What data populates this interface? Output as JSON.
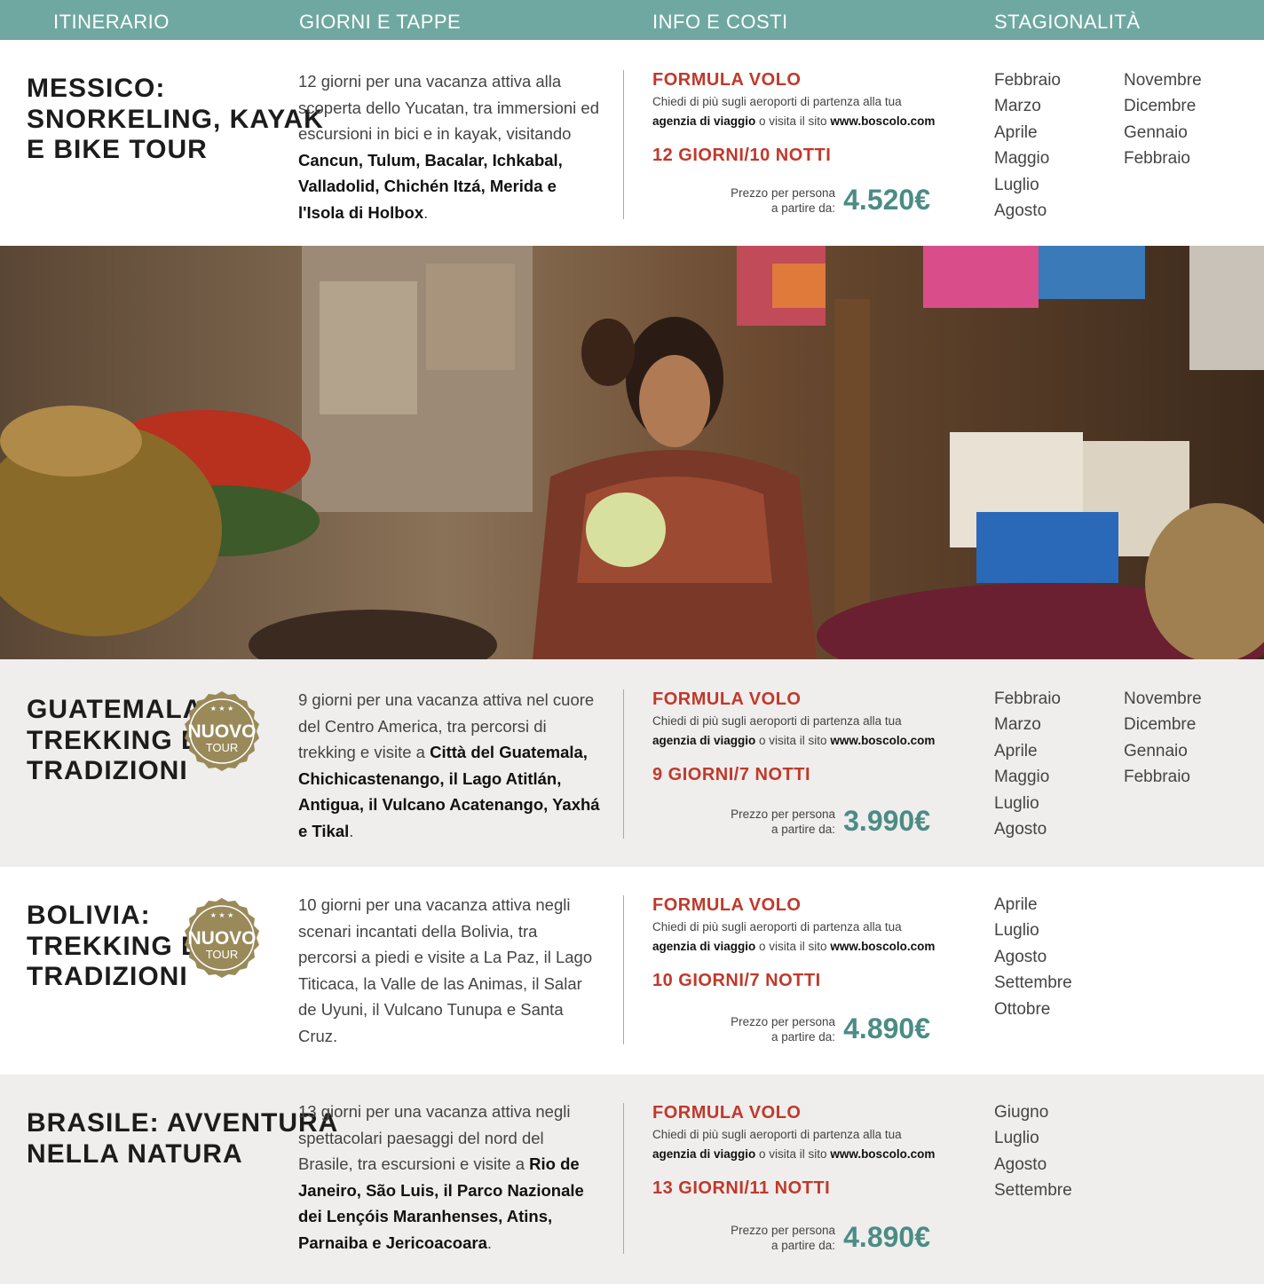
{
  "header": {
    "col1": "ITINERARIO",
    "col2": "GIORNI E TAPPE",
    "col3": "INFO E COSTI",
    "col4": "STAGIONALITÀ"
  },
  "common": {
    "formula": "FORMULA VOLO",
    "info_line1": "Chiedi di più sugli aeroporti di partenza alla tua",
    "info_agency": "agenzia di viaggio",
    "info_mid": " o visita il sito ",
    "info_site": "www.boscolo.com",
    "price_label1": "Prezzo per persona",
    "price_label2": "a partire da:",
    "badge_main": "NUOVO",
    "badge_sub": "TOUR"
  },
  "tours": [
    {
      "title1": "MESSICO:",
      "title2": "SNORKELING, KAYAK",
      "title3": "E BIKE TOUR",
      "desc_plain": "12 giorni per una vacanza attiva alla scoperta dello Yucatan, tra immersioni ed escursioni in bici e in kayak, visitando ",
      "desc_bold": "Cancun, Tulum, Bacalar, Ichkabal, Valladolid, Chichén Itzá, Merida e l'Isola di Holbox",
      "desc_end": ".",
      "nights": "12 GIORNI/10 NOTTI",
      "price": "4.520€",
      "months_a": [
        "Febbraio",
        "Marzo",
        "Aprile",
        "Maggio",
        "Luglio",
        "Agosto"
      ],
      "months_b": [
        "Novembre",
        "Dicembre",
        "Gennaio",
        "Febbraio"
      ]
    },
    {
      "title1": "GUATEMALA:",
      "title2": "TREKKING E",
      "title3": "TRADIZIONI",
      "desc_plain": "9 giorni per una vacanza attiva nel cuore del Centro America, tra percorsi di trekking e visite a ",
      "desc_bold": "Città del Guatemala, Chichicastenango, il Lago Atitlán, Antigua, il Vulcano Acatenango, Yaxhá e Tikal",
      "desc_end": ".",
      "nights": "9 GIORNI/7 NOTTI",
      "price": "3.990€",
      "months_a": [
        "Febbraio",
        "Marzo",
        "Aprile",
        "Maggio",
        "Luglio",
        "Agosto"
      ],
      "months_b": [
        "Novembre",
        "Dicembre",
        "Gennaio",
        "Febbraio"
      ]
    },
    {
      "title1": "BOLIVIA:",
      "title2": "TREKKING E",
      "title3": "TRADIZIONI",
      "desc_plain": "10 giorni per una vacanza attiva negli scenari incantati della Bolivia, tra percorsi a piedi e visite a La Paz, il Lago Titicaca, la Valle de las Animas, il Salar de Uyuni, il Vulcano Tunupa e Santa Cruz.",
      "desc_bold": "",
      "desc_end": "",
      "nights": "10 GIORNI/7 NOTTI",
      "price": "4.890€",
      "months_a": [
        "Aprile",
        "Luglio",
        "Agosto",
        "Settembre",
        "Ottobre"
      ],
      "months_b": []
    },
    {
      "title1": "BRASILE: AVVENTURA",
      "title2": "NELLA NATURA",
      "title3": "",
      "desc_plain": "13 giorni per una vacanza attiva negli spettacolari paesaggi del nord del Brasile, tra escursioni e visite a ",
      "desc_bold": "Rio de Janeiro, São Luis, il Parco Nazionale dei Lençóis Maranhenses, Atins, Parnaiba e Jericoacoara",
      "desc_end": ".",
      "nights": "13 GIORNI/11 NOTTI",
      "price": "4.890€",
      "months_a": [
        "Giugno",
        "Luglio",
        "Agosto",
        "Settembre"
      ],
      "months_b": []
    }
  ]
}
